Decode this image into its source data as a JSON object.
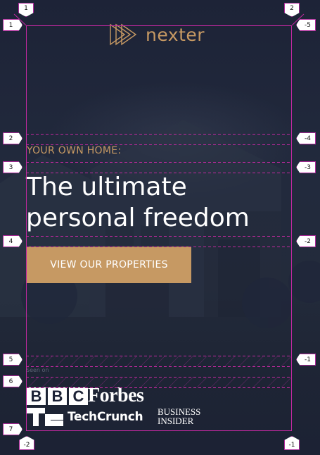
{
  "logo": {
    "name": "nexter",
    "color": "#c69963",
    "icon": "triangles-logo-icon"
  },
  "hero": {
    "eyebrow": "YOUR OWN HOME:",
    "headline_line1": "The ultimate",
    "headline_line2": "personal freedom",
    "cta_label": "VIEW OUR PROPERTIES"
  },
  "press": {
    "seen_on": "Seen on",
    "logos": {
      "bbc": [
        "B",
        "B",
        "C"
      ],
      "forbes": "Forbes",
      "techcrunch": "TechCrunch",
      "business_insider_line1": "BUSINESS",
      "business_insider_line2": "INSIDER"
    }
  },
  "guides": {
    "tags_left": [
      "1",
      "1",
      "2",
      "3",
      "4",
      "5",
      "6",
      "7"
    ],
    "tags_right": [
      "2",
      "-5",
      "-4",
      "-3",
      "-2",
      "-1"
    ],
    "tags_bottom": [
      "-2",
      "-1"
    ],
    "color": "#c0289f"
  },
  "colors": {
    "background": "#1c2236",
    "accent": "#c69963",
    "text": "#ffffff"
  }
}
